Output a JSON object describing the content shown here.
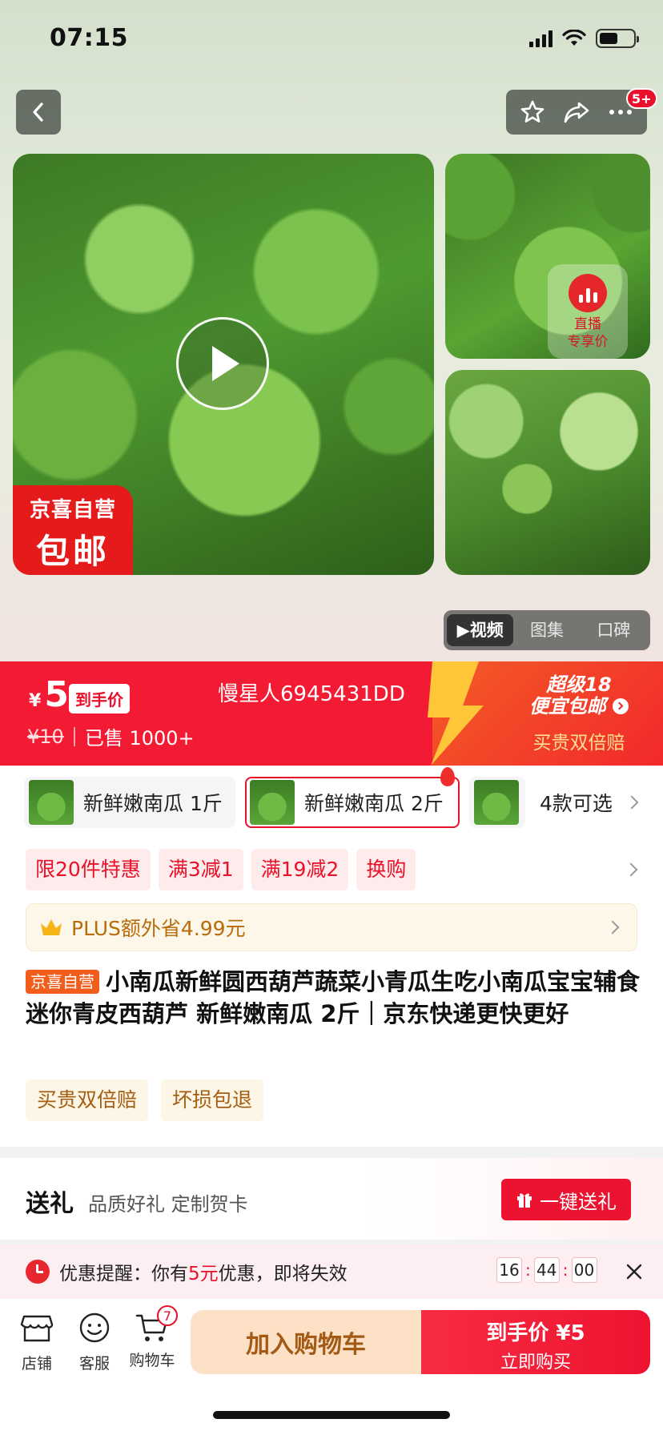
{
  "status_bar": {
    "time": "07:15"
  },
  "nav": {
    "message_badge": "5+"
  },
  "media": {
    "shipping_badge": {
      "line1": "京喜自营",
      "line2": "包邮"
    },
    "live_badge": {
      "line1": "直播",
      "line2": "专享价"
    },
    "tabs": [
      {
        "label": "▶视频",
        "active": true
      },
      {
        "label": "图集",
        "active": false
      },
      {
        "label": "口碑",
        "active": false
      }
    ]
  },
  "price": {
    "currency": "¥",
    "value": "5",
    "tag": "到手价",
    "original": "¥10",
    "sold": "已售 1000+",
    "user": "慢星人6945431DD",
    "promo_line1": "超级18",
    "promo_line2": "便宜包邮",
    "promo_sub": "买贵双倍赔"
  },
  "variants": {
    "items": [
      {
        "label": "新鲜嫩南瓜 1斤",
        "selected": false
      },
      {
        "label": "新鲜嫩南瓜 2斤",
        "selected": true
      },
      {
        "label": "",
        "selected": false
      }
    ],
    "count_label": "4款可选"
  },
  "promotions": [
    "限20件特惠",
    "满3减1",
    "满19减2",
    "换购"
  ],
  "plus": {
    "text": "PLUS额外省4.99元"
  },
  "product": {
    "store_tag": "京喜自营",
    "title": "小南瓜新鲜圆西葫芦蔬菜小青瓜生吃小南瓜宝宝辅食迷你青皮西葫芦 新鲜嫩南瓜 2斤｜京东快递更快更好"
  },
  "guarantees": [
    "买贵双倍赔",
    "坏损包退"
  ],
  "gift": {
    "title": "送礼",
    "subtitle": "品质好礼 定制贺卡",
    "button": "一键送礼"
  },
  "reminder": {
    "prefix": "优惠提醒：你有",
    "amount": "5元",
    "suffix": "优惠，即将失效",
    "timer": [
      "16",
      "44",
      "00"
    ]
  },
  "bottom_bar": {
    "store": "店铺",
    "service": "客服",
    "cart": "购物车",
    "cart_count": "7",
    "add_to_cart": "加入购物车",
    "buy_price": "到手价 ¥5",
    "buy_now": "立即购买"
  },
  "colors": {
    "accent": "#e8102a",
    "price_banner": "#f31b33",
    "add_cart_bg": "#fde1c6"
  }
}
